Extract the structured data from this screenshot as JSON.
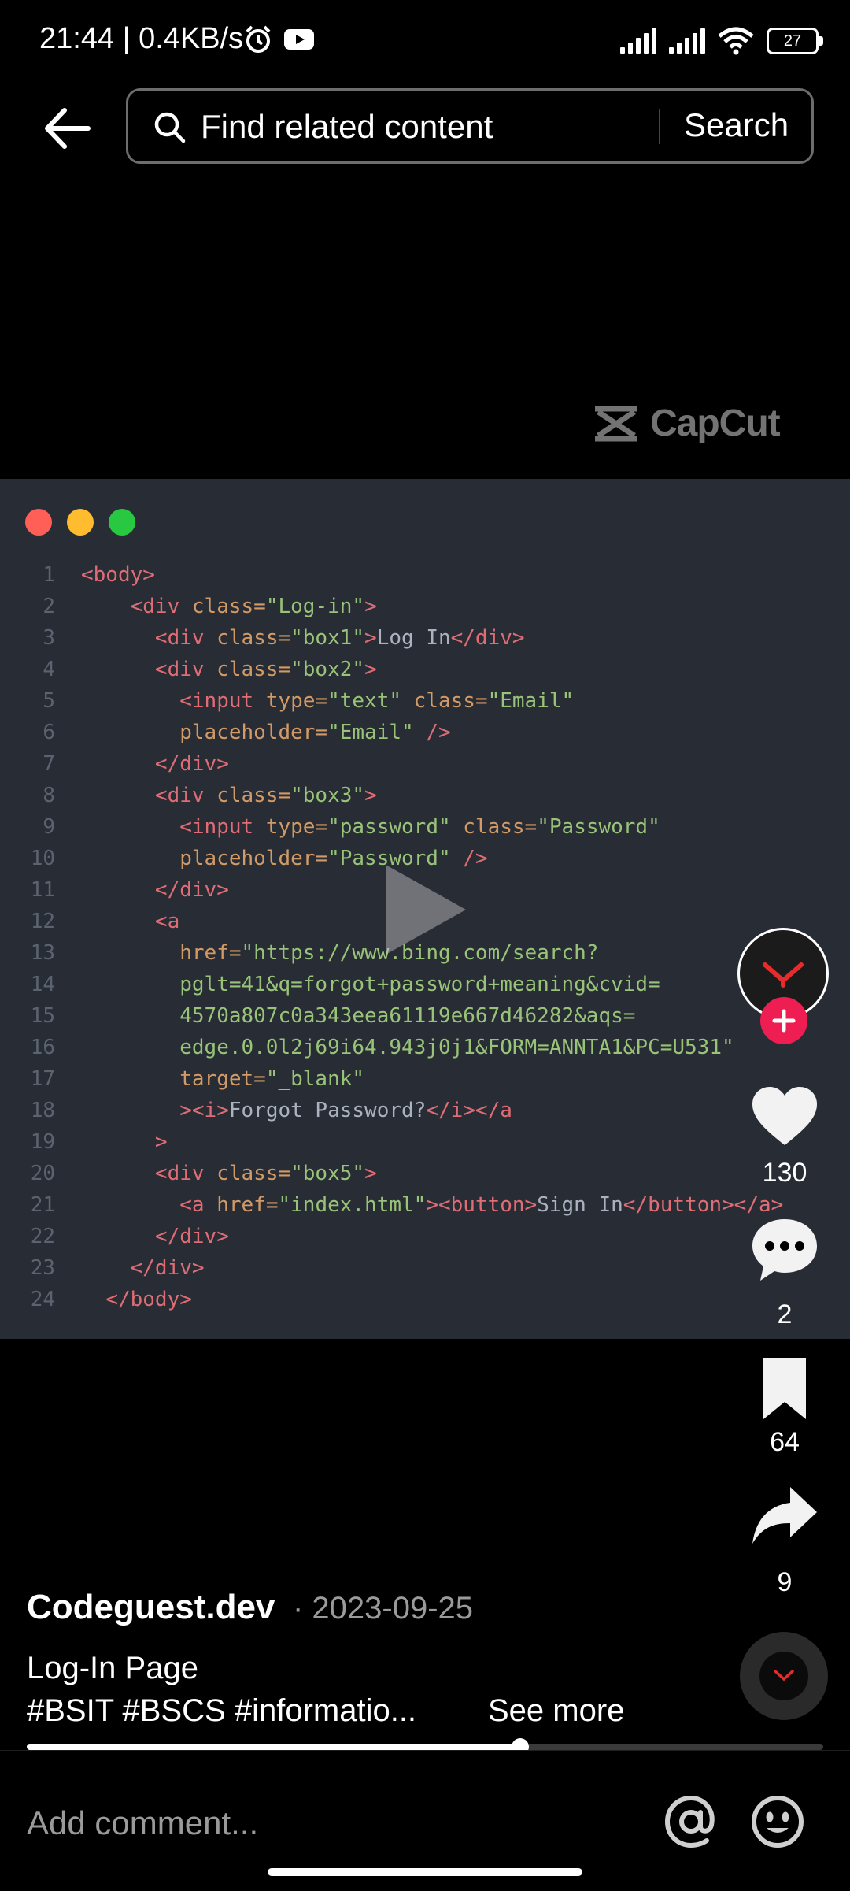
{
  "status_bar": {
    "time_speed": "21:44 | 0.4KB/s",
    "battery": "27"
  },
  "search": {
    "placeholder": "Find related content",
    "button": "Search"
  },
  "watermark": "CapCut",
  "code": {
    "lines": [
      {
        "n": "1",
        "tokens": [
          [
            "tg",
            "<body>"
          ]
        ]
      },
      {
        "n": "2",
        "tokens": [
          [
            "sp",
            "    "
          ],
          [
            "tg",
            "<div "
          ],
          [
            "at",
            "class="
          ],
          [
            "st",
            "\"Log-in\""
          ],
          [
            "tg",
            ">"
          ]
        ]
      },
      {
        "n": "3",
        "tokens": [
          [
            "sp",
            "      "
          ],
          [
            "tg",
            "<div "
          ],
          [
            "at",
            "class="
          ],
          [
            "st",
            "\"box1\""
          ],
          [
            "tg",
            ">"
          ],
          [
            "tx",
            "Log In"
          ],
          [
            "tg",
            "</div>"
          ]
        ]
      },
      {
        "n": "4",
        "tokens": [
          [
            "sp",
            "      "
          ],
          [
            "tg",
            "<div "
          ],
          [
            "at",
            "class="
          ],
          [
            "st",
            "\"box2\""
          ],
          [
            "tg",
            ">"
          ]
        ]
      },
      {
        "n": "5",
        "tokens": [
          [
            "sp",
            "        "
          ],
          [
            "tg",
            "<input "
          ],
          [
            "at",
            "type="
          ],
          [
            "st",
            "\"text\" "
          ],
          [
            "at",
            "class="
          ],
          [
            "st",
            "\"Email\""
          ]
        ]
      },
      {
        "n": "6",
        "tokens": [
          [
            "sp",
            "        "
          ],
          [
            "at",
            "placeholder="
          ],
          [
            "st",
            "\"Email\" "
          ],
          [
            "tg",
            "/>"
          ]
        ]
      },
      {
        "n": "7",
        "tokens": [
          [
            "sp",
            "      "
          ],
          [
            "tg",
            "</div>"
          ]
        ]
      },
      {
        "n": "8",
        "tokens": [
          [
            "sp",
            "      "
          ],
          [
            "tg",
            "<div "
          ],
          [
            "at",
            "class="
          ],
          [
            "st",
            "\"box3\""
          ],
          [
            "tg",
            ">"
          ]
        ]
      },
      {
        "n": "9",
        "tokens": [
          [
            "sp",
            "        "
          ],
          [
            "tg",
            "<input "
          ],
          [
            "at",
            "type="
          ],
          [
            "st",
            "\"password\" "
          ],
          [
            "at",
            "class="
          ],
          [
            "st",
            "\"Password\""
          ]
        ]
      },
      {
        "n": "10",
        "tokens": [
          [
            "sp",
            "        "
          ],
          [
            "at",
            "placeholder="
          ],
          [
            "st",
            "\"Password\" "
          ],
          [
            "tg",
            "/>"
          ]
        ]
      },
      {
        "n": "11",
        "tokens": [
          [
            "sp",
            "      "
          ],
          [
            "tg",
            "</div>"
          ]
        ]
      },
      {
        "n": "12",
        "tokens": [
          [
            "sp",
            "      "
          ],
          [
            "tg",
            "<a"
          ]
        ]
      },
      {
        "n": "13",
        "tokens": [
          [
            "sp",
            "        "
          ],
          [
            "at",
            "href="
          ],
          [
            "st",
            "\"https://www.bing.com/search?"
          ]
        ]
      },
      {
        "n": "14",
        "tokens": [
          [
            "sp",
            "        "
          ],
          [
            "st",
            "pglt=41&q=forgot+password+meaning&cvid="
          ]
        ]
      },
      {
        "n": "15",
        "tokens": [
          [
            "sp",
            "        "
          ],
          [
            "st",
            "4570a807c0a343eea61119e667d46282&aqs="
          ]
        ]
      },
      {
        "n": "16",
        "tokens": [
          [
            "sp",
            "        "
          ],
          [
            "st",
            "edge.0.0l2j69i64.943j0j1&FORM=ANNTA1&PC=U531\""
          ]
        ]
      },
      {
        "n": "17",
        "tokens": [
          [
            "sp",
            "        "
          ],
          [
            "at",
            "target="
          ],
          [
            "st",
            "\"_blank\""
          ]
        ]
      },
      {
        "n": "18",
        "tokens": [
          [
            "sp",
            "        "
          ],
          [
            "tg",
            "><i>"
          ],
          [
            "tx",
            "Forgot Password?"
          ],
          [
            "tg",
            "</i></a"
          ]
        ]
      },
      {
        "n": "19",
        "tokens": [
          [
            "sp",
            "      "
          ],
          [
            "tg",
            ">"
          ]
        ]
      },
      {
        "n": "20",
        "tokens": [
          [
            "sp",
            "      "
          ],
          [
            "tg",
            "<div "
          ],
          [
            "at",
            "class="
          ],
          [
            "st",
            "\"box5\""
          ],
          [
            "tg",
            ">"
          ]
        ]
      },
      {
        "n": "21",
        "tokens": [
          [
            "sp",
            "        "
          ],
          [
            "tg",
            "<a "
          ],
          [
            "at",
            "href="
          ],
          [
            "st",
            "\"index.html\""
          ],
          [
            "tg",
            "><button>"
          ],
          [
            "tx",
            "Sign In"
          ],
          [
            "tg",
            "</button></a>"
          ]
        ]
      },
      {
        "n": "22",
        "tokens": [
          [
            "sp",
            "      "
          ],
          [
            "tg",
            "</div>"
          ]
        ]
      },
      {
        "n": "23",
        "tokens": [
          [
            "sp",
            "    "
          ],
          [
            "tg",
            "</div>"
          ]
        ]
      },
      {
        "n": "24",
        "tokens": [
          [
            "sp",
            "  "
          ],
          [
            "tg",
            "</body>"
          ]
        ]
      }
    ]
  },
  "actions": {
    "likes": "130",
    "comments": "2",
    "saves": "64",
    "shares": "9"
  },
  "post": {
    "author": "Codeguest.dev",
    "date": "· 2023-09-25",
    "title": "Log-In Page",
    "tags": "#BSIT  #BSCS  #informatio...",
    "see_more": "See more"
  },
  "progress": {
    "fraction": 0.62
  },
  "comment": {
    "placeholder": "Add comment..."
  },
  "colors": {
    "accent": "#ee1d52",
    "code_bg": "#282c34"
  }
}
